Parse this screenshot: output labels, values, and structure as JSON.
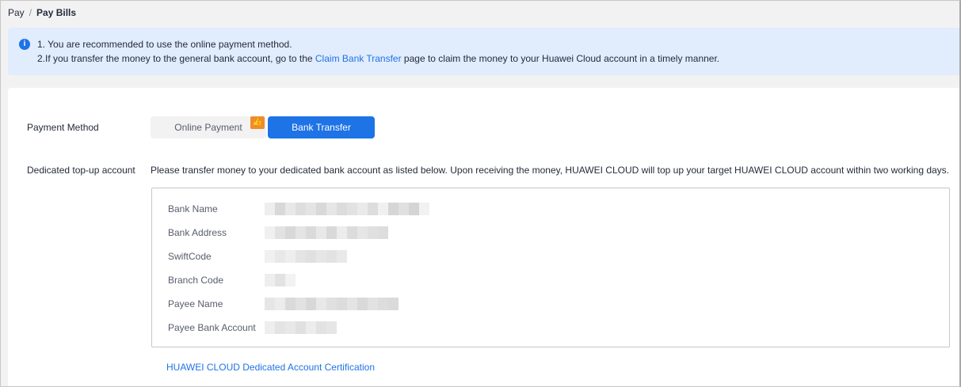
{
  "breadcrumb": {
    "root": "Pay",
    "separator": "/",
    "current": "Pay Bills"
  },
  "notice": {
    "icon": "info-icon",
    "line1": "1. You are recommended to use the online payment method.",
    "line2_before": "2.If you transfer the money to the general bank account, go to the ",
    "line2_link": "Claim Bank Transfer",
    "line2_after": " page to claim the money to your Huawei Cloud account in a timely manner."
  },
  "payment": {
    "label": "Payment Method",
    "online_label": "Online Payment",
    "recommend_icon": "thumbs-up-icon",
    "bank_label": "Bank Transfer",
    "selected": "Bank Transfer"
  },
  "account": {
    "label": "Dedicated top-up account",
    "description": "Please transfer money to your dedicated bank account as listed below. Upon receiving the money, HUAWEI CLOUD will top up your target HUAWEI CLOUD account within two working days.",
    "fields": [
      {
        "key": "Bank Name"
      },
      {
        "key": "Bank Address"
      },
      {
        "key": "SwiftCode"
      },
      {
        "key": "Branch Code"
      },
      {
        "key": "Payee Name"
      },
      {
        "key": "Payee Bank Account"
      }
    ],
    "cert_link": "HUAWEI CLOUD Dedicated Account Certification"
  }
}
